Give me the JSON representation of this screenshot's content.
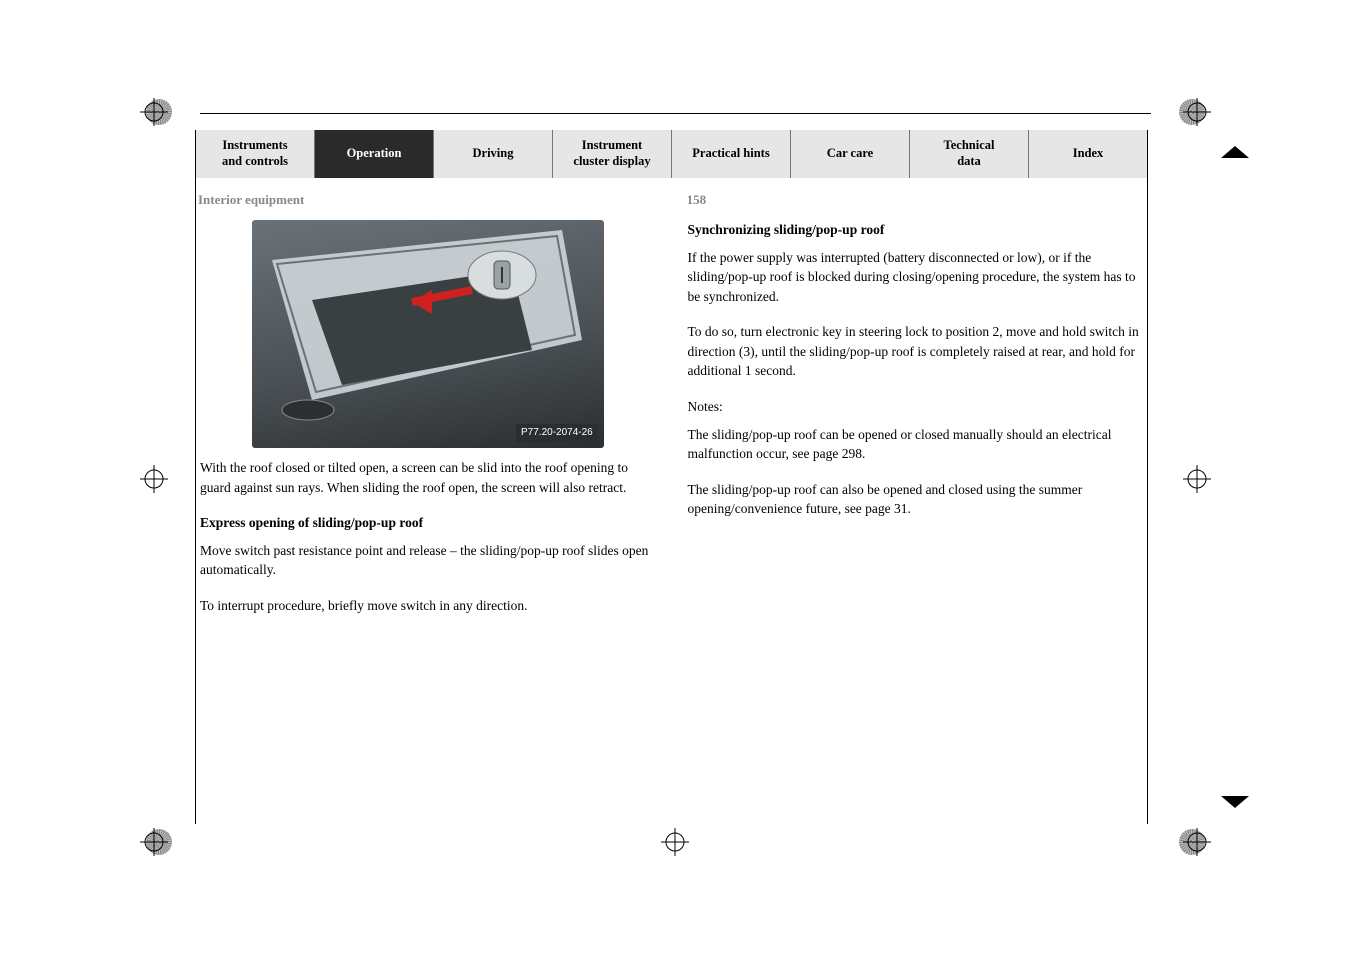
{
  "tabs": {
    "instruments_controls": "Instruments\nand controls",
    "operation": "Operation",
    "driving": "Driving",
    "instrument_cluster": "Instrument\ncluster display",
    "practical_hints": "Practical hints",
    "car_care": "Car care",
    "technical_data": "Technical\ndata",
    "index": "Index"
  },
  "header": {
    "section": "Interior equipment",
    "page": "158"
  },
  "figure": {
    "caption": "P77.20-2074-26"
  },
  "left": {
    "p1": "With the roof closed or tilted open, a screen can be slid into the roof opening to guard against sun rays. When sliding the roof open, the screen will also retract.",
    "h1": "Express opening of sliding/pop-up roof",
    "p2": "Move switch past resistance point and release – the sliding/pop-up roof slides open automatically.",
    "p3": "To interrupt procedure, briefly move switch in any direction."
  },
  "right": {
    "h1": "Synchronizing sliding/pop-up roof",
    "p1": "If the power supply was interrupted (battery disconnected or low), or if the sliding/pop-up roof is blocked during closing/opening procedure, the system has to be synchronized.",
    "p2": "To do so, turn electronic key in steering lock to position 2, move and hold switch in direction (3), until the sliding/pop-up roof is completely raised at rear, and hold for additional 1 second.",
    "notes": "Notes:",
    "p3": "The sliding/pop-up roof can be opened or closed manually should an electrical malfunction occur, see page 298.",
    "p4": "The sliding/pop-up roof can also be opened and closed using the summer opening/convenience future, see page 31."
  }
}
